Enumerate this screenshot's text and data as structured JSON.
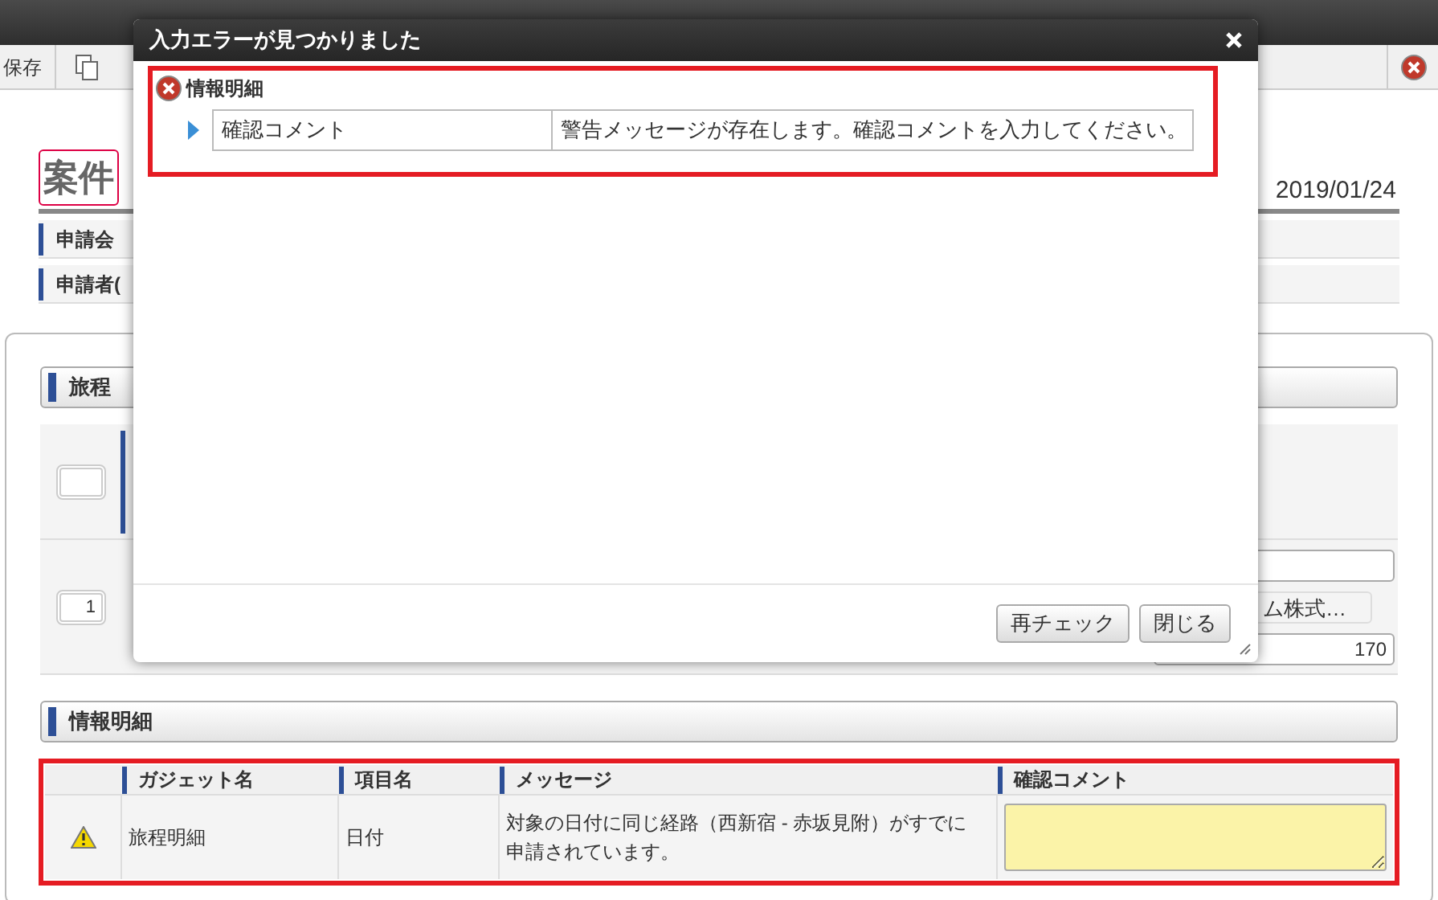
{
  "toolbar": {
    "save_button": "保存"
  },
  "header": {
    "title": "案件",
    "date": "2019/01/24",
    "fields": [
      "申請会",
      "申請者("
    ]
  },
  "itinerary": {
    "title": "旅程",
    "checked": false,
    "row_number": "1",
    "company": "ム株式…",
    "amount": "170"
  },
  "info_section": {
    "title": "情報明細",
    "columns": [
      "ガジェット名",
      "項目名",
      "メッセージ",
      "確認コメント"
    ],
    "rows": [
      {
        "kind": "warning",
        "gadget": "旅程明細",
        "item": "日付",
        "message": "対象の日付に同じ経路（西新宿 - 赤坂見附）がすでに申請されています。"
      }
    ]
  },
  "dialog": {
    "title": "入力エラーが見つかりました",
    "group": {
      "title": "情報明細",
      "items": [
        {
          "field": "確認コメント",
          "message": "警告メッセージが存在します。確認コメントを入力してください。"
        }
      ]
    },
    "buttons": [
      "再チェック",
      "閉じる"
    ]
  }
}
